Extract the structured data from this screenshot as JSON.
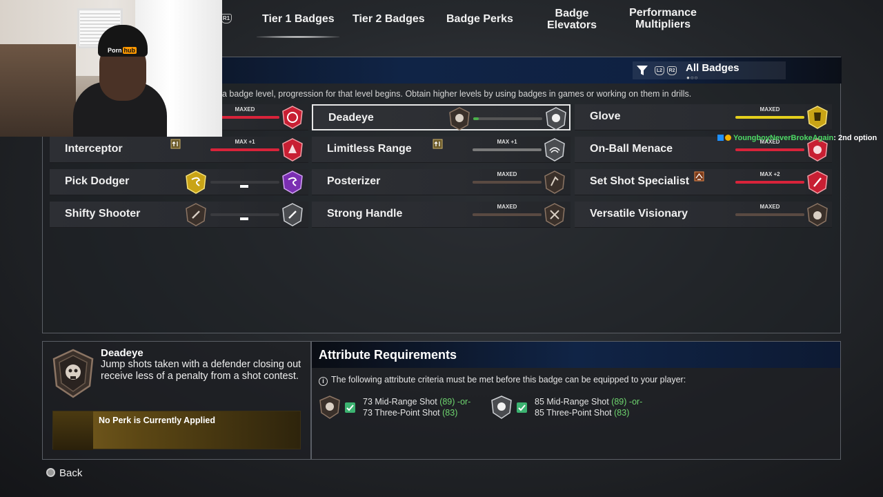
{
  "tabs": {
    "r1": "R1",
    "items": [
      "Tier 1 Badges",
      "Tier 2 Badges",
      "Badge Perks",
      "Badge Elevators",
      "Performance Multipliers"
    ],
    "active": "Tier 1 Badges"
  },
  "webcam": {
    "hat_text": "Porn",
    "hat_logo": "hub"
  },
  "filter": {
    "label": "All Badges",
    "l2": "L2",
    "r2": "R2",
    "dots": "●○○"
  },
  "instructions": "a badge level, progression for that level begins. Obtain higher levels by using badges in games or working on them in drills.",
  "badges": {
    "row1": {
      "c1": {
        "tag": "MAXED"
      },
      "c2": {
        "name": "Deadeye"
      },
      "c3": {
        "name": "Glove",
        "tag": "MAXED"
      }
    },
    "row2": {
      "c1": {
        "name": "Interceptor",
        "tag": "MAX +1"
      },
      "c2": {
        "name": "Limitless Range",
        "tag": "MAX +1"
      },
      "c3": {
        "name": "On-Ball Menace",
        "tag": "MAXED"
      }
    },
    "row3": {
      "c1": {
        "name": "Pick Dodger"
      },
      "c2": {
        "name": "Posterizer",
        "tag": "MAXED"
      },
      "c3": {
        "name": "Set Shot Specialist",
        "tag": "MAX +2"
      }
    },
    "row4": {
      "c1": {
        "name": "Shifty Shooter"
      },
      "c2": {
        "name": "Strong Handle",
        "tag": "MAXED"
      },
      "c3": {
        "name": "Versatile Visionary",
        "tag": "MAXED"
      }
    }
  },
  "chat": {
    "user": "YoungboyNeverBrokeAgain",
    "message": ": 2nd option"
  },
  "detail": {
    "title": "Deadeye",
    "description": "Jump shots taken with a defender closing out receive less of a penalty from a shot contest.",
    "perk": "No Perk is Currently Applied"
  },
  "attributes": {
    "title": "Attribute Requirements",
    "info": "The following attribute criteria must be met before this badge can be equipped to your player:",
    "req1": {
      "line1_label": "73 Mid-Range Shot",
      "line1_value": "(89)",
      "or": "-or-",
      "line2_label": "73 Three-Point Shot",
      "line2_value": "(83)"
    },
    "req2": {
      "line1_label": "85 Mid-Range Shot",
      "line1_value": "(89)",
      "or": "-or-",
      "line2_label": "85 Three-Point Shot",
      "line2_value": "(83)"
    }
  },
  "back": "Back",
  "colors": {
    "red_bar": "#d8233a",
    "yellow_bar": "#e4cf1d",
    "grey_bar": "#7a7a7a",
    "green": "#6fd66f"
  }
}
